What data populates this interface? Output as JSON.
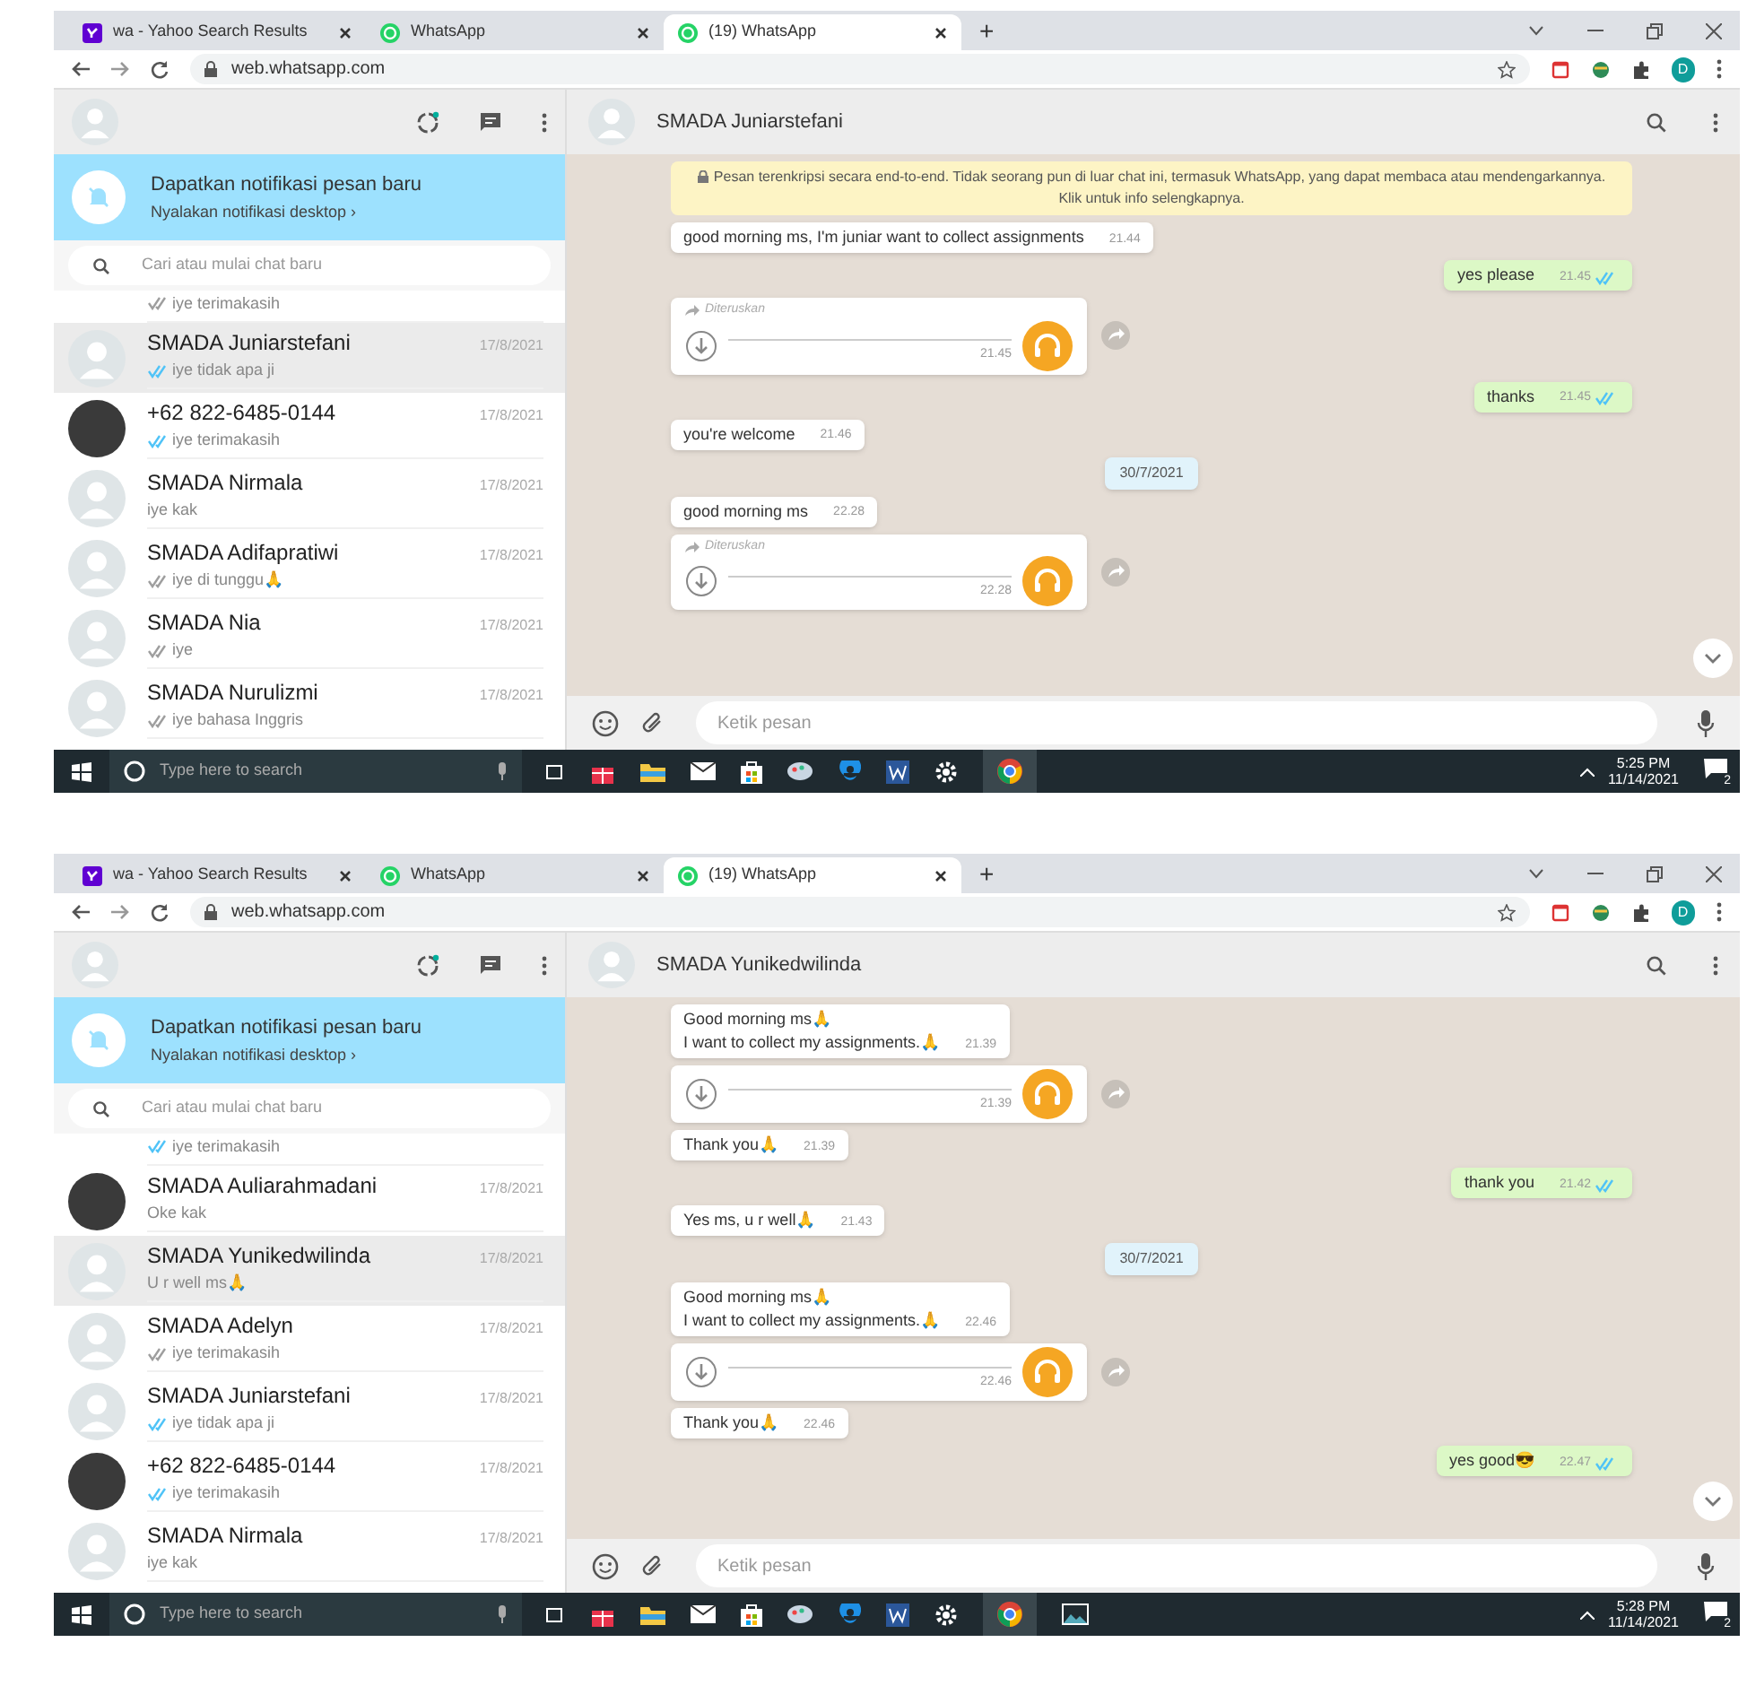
{
  "screens": [
    {
      "browser": {
        "tabs": [
          {
            "label": "wa - Yahoo Search Results",
            "selected": false
          },
          {
            "label": "WhatsApp",
            "selected": false
          },
          {
            "label": "(19) WhatsApp",
            "selected": true
          }
        ],
        "new_tab": "+",
        "url": "web.whatsapp.com",
        "profile": "D"
      },
      "sidebar": {
        "notification": {
          "title": "Dapatkan notifikasi pesan baru",
          "subtitle": "Nyalakan notifikasi desktop ›"
        },
        "search_placeholder": "Cari atau mulai chat baru",
        "chats": [
          {
            "preview": "iye terimakasih",
            "ticks": true,
            "read": false,
            "selected": false
          },
          {
            "name": "SMADA Juniarstefani",
            "preview": "iye tidak apa ji",
            "date": "17/8/2021",
            "ticks": true,
            "read": true,
            "photo": false,
            "selected": true
          },
          {
            "name": "+62 822-6485-0144",
            "preview": "iye terimakasih",
            "date": "17/8/2021",
            "ticks": true,
            "read": true,
            "photo": true,
            "selected": false
          },
          {
            "name": "SMADA Nirmala",
            "preview": "iye kak",
            "date": "17/8/2021",
            "ticks": false,
            "photo": false,
            "selected": false
          },
          {
            "name": "SMADA Adifapratiwi",
            "preview": "iye di tunggu🙏",
            "date": "17/8/2021",
            "ticks": true,
            "read": false,
            "photo": false,
            "selected": false
          },
          {
            "name": "SMADA Nia",
            "preview": "iye",
            "date": "17/8/2021",
            "ticks": true,
            "read": false,
            "photo": false,
            "selected": false
          },
          {
            "name": "SMADA Nurulizmi",
            "preview": "iye bahasa Inggris",
            "date": "17/8/2021",
            "ticks": true,
            "read": false,
            "photo": false,
            "selected": false
          }
        ]
      },
      "chat": {
        "name": "SMADA Juniarstefani",
        "input_placeholder": "Ketik pesan",
        "messages": [
          {
            "kind": "notice",
            "text": "Pesan terenkripsi secara end-to-end. Tidak seorang pun di luar chat ini, termasuk WhatsApp, yang dapat membaca atau mendengarkannya. Klik untuk info selengkapnya."
          },
          {
            "kind": "text",
            "outgoing": false,
            "text": "good morning ms, I'm juniar want to collect assignments",
            "time": "21.44"
          },
          {
            "kind": "text",
            "outgoing": true,
            "text": "yes please",
            "time": "21.45",
            "read": true
          },
          {
            "kind": "voice",
            "outgoing": false,
            "forwarded": "Diteruskan",
            "time": "21.45"
          },
          {
            "kind": "text",
            "outgoing": true,
            "text": "thanks",
            "time": "21.45",
            "read": true
          },
          {
            "kind": "text",
            "outgoing": false,
            "text": "you're welcome",
            "time": "21.46"
          },
          {
            "kind": "date",
            "text": "30/7/2021"
          },
          {
            "kind": "text",
            "outgoing": false,
            "text": "good morning ms",
            "time": "22.28"
          },
          {
            "kind": "voice",
            "outgoing": false,
            "forwarded": "Diteruskan",
            "time": "22.28"
          }
        ]
      },
      "taskbar": {
        "search_placeholder": "Type here to search",
        "time": "5:25 PM",
        "date": "11/14/2021",
        "notifications": "2",
        "photos_app_open": false
      }
    },
    {
      "browser": {
        "tabs": [
          {
            "label": "wa - Yahoo Search Results",
            "selected": false
          },
          {
            "label": "WhatsApp",
            "selected": false
          },
          {
            "label": "(19) WhatsApp",
            "selected": true
          }
        ],
        "new_tab": "+",
        "url": "web.whatsapp.com",
        "profile": "D"
      },
      "sidebar": {
        "notification": {
          "title": "Dapatkan notifikasi pesan baru",
          "subtitle": "Nyalakan notifikasi desktop ›"
        },
        "search_placeholder": "Cari atau mulai chat baru",
        "chats": [
          {
            "preview": "iye terimakasih",
            "ticks": true,
            "read": true,
            "selected": false
          },
          {
            "name": "SMADA Auliarahmadani",
            "preview": "Oke kak",
            "date": "17/8/2021",
            "ticks": false,
            "photo": true,
            "selected": false
          },
          {
            "name": "SMADA Yunikedwilinda",
            "preview": "U r well ms🙏",
            "date": "17/8/2021",
            "ticks": false,
            "photo": false,
            "selected": true
          },
          {
            "name": "SMADA Adelyn",
            "preview": "iye terimakasih",
            "date": "17/8/2021",
            "ticks": true,
            "read": false,
            "photo": false,
            "selected": false
          },
          {
            "name": "SMADA Juniarstefani",
            "preview": "iye tidak apa ji",
            "date": "17/8/2021",
            "ticks": true,
            "read": true,
            "photo": false,
            "selected": false
          },
          {
            "name": "+62 822-6485-0144",
            "preview": "iye terimakasih",
            "date": "17/8/2021",
            "ticks": true,
            "read": true,
            "photo": true,
            "selected": false
          },
          {
            "name": "SMADA Nirmala",
            "preview": "iye kak",
            "date": "17/8/2021",
            "ticks": false,
            "photo": false,
            "selected": false
          }
        ]
      },
      "chat": {
        "name": "SMADA Yunikedwilinda",
        "input_placeholder": "Ketik pesan",
        "messages": [
          {
            "kind": "text",
            "outgoing": false,
            "text": "Good morning ms🙏\nI want to collect my assignments.🙏",
            "time": "21.39"
          },
          {
            "kind": "voice",
            "outgoing": false,
            "time": "21.39"
          },
          {
            "kind": "text",
            "outgoing": false,
            "text": "Thank you🙏",
            "time": "21.39"
          },
          {
            "kind": "text",
            "outgoing": true,
            "text": "thank you",
            "time": "21.42",
            "read": true
          },
          {
            "kind": "text",
            "outgoing": false,
            "text": "Yes ms, u r well🙏",
            "time": "21.43"
          },
          {
            "kind": "date",
            "text": "30/7/2021"
          },
          {
            "kind": "text",
            "outgoing": false,
            "text": "Good morning ms🙏\nI want to collect my assignments.🙏",
            "time": "22.46"
          },
          {
            "kind": "voice",
            "outgoing": false,
            "time": "22.46"
          },
          {
            "kind": "text",
            "outgoing": false,
            "text": "Thank you🙏",
            "time": "22.46"
          },
          {
            "kind": "text",
            "outgoing": true,
            "text": "yes good😎",
            "time": "22.47",
            "read": true
          }
        ]
      },
      "taskbar": {
        "search_placeholder": "Type here to search",
        "time": "5:28 PM",
        "date": "11/14/2021",
        "notifications": "2",
        "photos_app_open": true
      }
    }
  ]
}
